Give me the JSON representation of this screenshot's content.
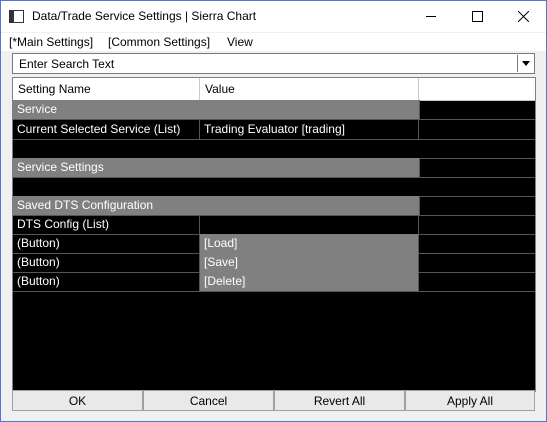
{
  "window": {
    "title": "Data/Trade Service Settings | Sierra Chart"
  },
  "menu": {
    "items": [
      "[*Main Settings]",
      "[Common Settings]",
      "View"
    ]
  },
  "search": {
    "placeholder": "Enter Search Text"
  },
  "table": {
    "columns": [
      "Setting Name",
      "Value"
    ],
    "rows": [
      {
        "kind": "section",
        "name": "Service"
      },
      {
        "kind": "setting",
        "name": "Current Selected Service (List)",
        "value": "Trading Evaluator    [trading]"
      },
      {
        "kind": "blank"
      },
      {
        "kind": "section",
        "name": "Service Settings"
      },
      {
        "kind": "blank"
      },
      {
        "kind": "section",
        "name": "Saved DTS Configuration"
      },
      {
        "kind": "setting",
        "name": "DTS Config (List)",
        "value": ""
      },
      {
        "kind": "button",
        "name": " (Button)",
        "value": "[Load]"
      },
      {
        "kind": "button",
        "name": " (Button)",
        "value": "[Save]"
      },
      {
        "kind": "button",
        "name": " (Button)",
        "value": "[Delete]"
      }
    ]
  },
  "footer": {
    "ok": "OK",
    "cancel": "Cancel",
    "revert": "Revert All",
    "apply": "Apply All"
  }
}
